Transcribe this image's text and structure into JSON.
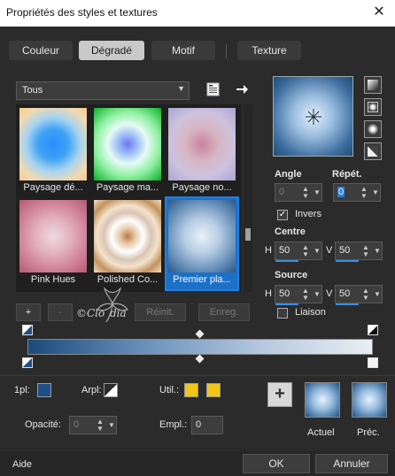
{
  "window": {
    "title": "Propriétés des styles et textures",
    "close_glyph": "✕"
  },
  "tabs": [
    {
      "label": "Couleur",
      "active": false
    },
    {
      "label": "Dégradé",
      "active": true
    },
    {
      "label": "Motif",
      "active": false
    },
    {
      "label": "Texture",
      "active": false
    }
  ],
  "category": {
    "selected": "Tous"
  },
  "gradients": [
    {
      "label": "Paysage dé...",
      "selected": false
    },
    {
      "label": "Paysage ma...",
      "selected": false
    },
    {
      "label": "Paysage no...",
      "selected": false
    },
    {
      "label": "Pink Hues",
      "selected": false
    },
    {
      "label": "Polished Co...",
      "selected": false
    },
    {
      "label": "Premier pla...",
      "selected": true
    }
  ],
  "properties": {
    "angle_label": "Angle",
    "angle_value": "0",
    "repeat_label": "Répét.",
    "repeat_value": "0",
    "invert_label": "Invers",
    "invert_checked": true,
    "center_label": "Centre",
    "center_h_label": "H",
    "center_h": "50",
    "center_v_label": "V",
    "center_v": "50",
    "source_label": "Source",
    "source_h_label": "H",
    "source_h": "50",
    "source_v_label": "V",
    "source_v": "50",
    "link_label": "Liaison",
    "link_checked": false
  },
  "editor": {
    "add_label": "+",
    "remove_label": "-",
    "reset_label": "Réinit.",
    "save_label": "Enreg."
  },
  "stop_props": {
    "pl_label": "1pl:",
    "pl_color": "#1f4f86",
    "arpl_label": "Arpl:",
    "util_label": "Util.:",
    "util_color1": "#f2c519",
    "util_color2": "#f2c519",
    "opacity_label": "Opacité:",
    "opacity_value": "0",
    "empl_label": "Empl.:",
    "empl_value": "0"
  },
  "swatches": {
    "actual_label": "Actuel",
    "previous_label": "Préc."
  },
  "footer": {
    "help_label": "Aide",
    "ok_label": "OK",
    "cancel_label": "Annuler"
  },
  "colors": {
    "accent": "#1f7fe0",
    "background": "#2b2b2b"
  }
}
